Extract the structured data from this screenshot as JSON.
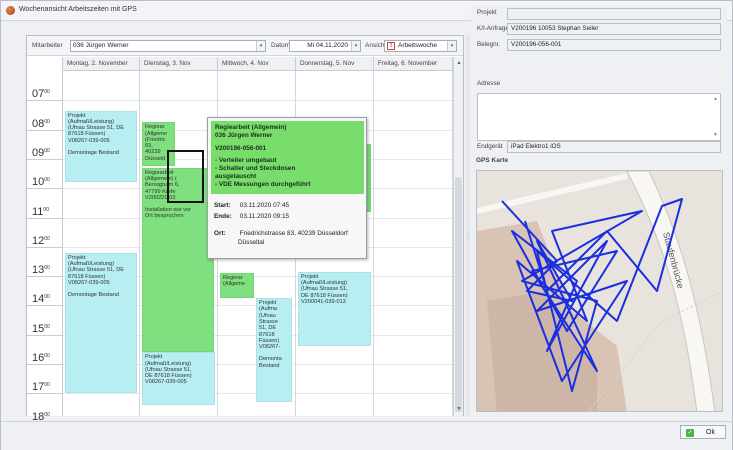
{
  "window": {
    "title": "Wochenansicht Arbeitszeiten mit GPS",
    "restore_glyph": "⧉",
    "close_glyph": "✕"
  },
  "toolbar": {
    "mitarbeiter_label": "Mitarbeiter",
    "mitarbeiter_value": "036 Jürgen Werner",
    "datum_label": "Datum",
    "datum_value": "Mi 04.11.2020",
    "ansicht_label": "Ansicht",
    "ansicht_value": "Arbeitswoche",
    "dropdown_glyph": "▾",
    "calendar_glyph": "3"
  },
  "days": [
    "Montag, 2. November",
    "Dienstag, 3. Nov",
    "Mittwoch, 4. Nov",
    "Donnerstag, 5. Nov",
    "Freitag, 6. November"
  ],
  "hours": [
    "07",
    "08",
    "09",
    "10",
    "11",
    "12",
    "13",
    "14",
    "15",
    "16",
    "17",
    "18"
  ],
  "hour_suffix": "00",
  "events": [
    {
      "day": 0,
      "start": 7.35,
      "end": 9.8,
      "color": "cyan",
      "lines": [
        "Projekt",
        "(Aufmaß/Leistung)",
        "(Ufnau Strasse 51, DE",
        "87618 Füssen)",
        "V08267-039-005",
        "",
        "Demontage Bestand"
      ]
    },
    {
      "day": 0,
      "start": 12.2,
      "end": 17.0,
      "color": "cyan",
      "lines": [
        "Projekt",
        "(Aufmaß/Leistung)",
        "(Ufnau Strasse 51, DE",
        "87618 Füssen)",
        "V08267-039-005",
        "",
        "Demontage Bestand"
      ]
    },
    {
      "day": 1,
      "start": 7.75,
      "end": 9.25,
      "color": "green",
      "lines": [
        "Regiear",
        "(Allgeme",
        "(Friedric",
        "83,",
        "40239",
        "Düsseld"
      ]
    },
    {
      "day": 1,
      "start": 9.3,
      "end": 15.6,
      "color": "green",
      "lines": [
        "Regiearbeit",
        "(Allgemein) (",
        "Bensigturm 6,",
        "47799 Krefe",
        "V200221-03",
        "",
        "Installation wie vor",
        "Ort besprochen"
      ]
    },
    {
      "day": 1,
      "start": 15.6,
      "end": 17.4,
      "color": "cyan",
      "lines": [
        "Projekt",
        "(Aufmaß/Leistung)",
        "(Ufnau Strasse 51,",
        "DE 87618 Füssen)",
        "V08267-039-005"
      ]
    },
    {
      "day": 2,
      "start": 12.9,
      "end": 13.75,
      "color": "green",
      "lines": [
        "Regiear",
        "(Allgeme"
      ]
    },
    {
      "day": 2,
      "start": 13.75,
      "end": 17.3,
      "color": "cyan",
      "lines": [
        "Projekt",
        "(Aufma",
        "(Ufnau",
        "Strasse",
        "51, DE",
        "87618",
        "Füssen)",
        "V08267-",
        "",
        "Demonta",
        "Bestand"
      ]
    },
    {
      "day": 3,
      "start": 8.5,
      "end": 10.8,
      "color": "green",
      "lines": [
        "An",
        "7, DE",
        "d)",
        "-001",
        "",
        "ie vor",
        "en"
      ]
    },
    {
      "day": 3,
      "start": 12.85,
      "end": 15.4,
      "color": "cyan",
      "lines": [
        "Projekt",
        "(Aufmaß/Leistung)",
        "(Ufnau Strasse 51,",
        "DE 87618 Füssen)",
        "V200041-039-013"
      ]
    }
  ],
  "tooltip": {
    "title1": "Regiearbeit (Allgemein)",
    "title2": "036 Jürgen Werner",
    "number": "V200196-056-001",
    "note1": "- Verteiler umgebaut",
    "note2": "- Schalter und Steckdosen",
    "note3": "ausgetauscht",
    "note4": "- VDE Messungen durchgeführt",
    "start_label": "Start:",
    "start_value": "03.11.2020  07:45",
    "end_label": "Ende:",
    "end_value": "03.11.2020  09:15",
    "ort_label": "Ort:",
    "ort_value1": "Friedrichstrasse 83, 40239 Düsseldorf",
    "ort_value2": "Düsseltal"
  },
  "right_panel": {
    "projekt_label": "Projekt",
    "projekt_value": "",
    "kanfrage_label": "K/I-Anfrage",
    "kanfrage_value": "V200196 10053 Stephan Seiler",
    "belegnr_label": "Belegnr.",
    "belegnr_value": "V200196-056-001",
    "adresse_label": "Adresse",
    "endgeraet_label": "Endgerät",
    "endgeraet_value": "iPad Elektro1 iOS",
    "gps_header": "GPS Karte",
    "map_street": "Staufenbrücke",
    "colors": {
      "track": "#1b2ee0",
      "building": "#d8c3b4",
      "road": "#f8f7f4"
    }
  },
  "ok_label": "Ok",
  "ok_glyph": "✓"
}
